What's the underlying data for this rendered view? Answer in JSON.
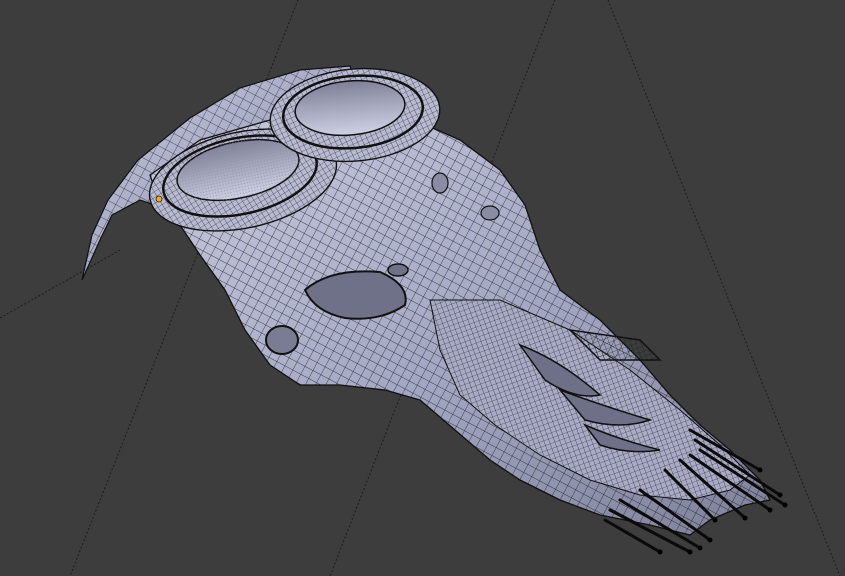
{
  "viewport": {
    "mode": "edit-mode-wireframe-overlay",
    "mesh_color": "#9a9db8",
    "wire_color": "#111111",
    "background_color": "#3d3d3d",
    "guide_line_color": "#1a1a1a",
    "active_vertex_color": "#f5a623"
  }
}
